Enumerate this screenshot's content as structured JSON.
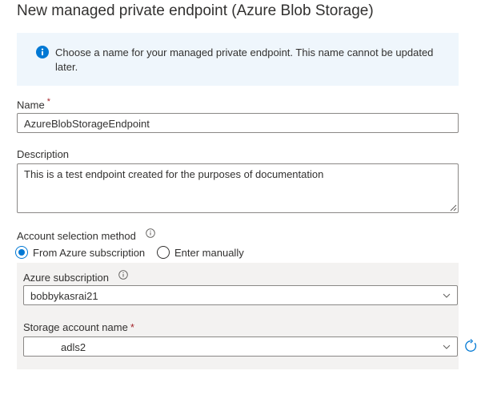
{
  "title": "New managed private endpoint (Azure Blob Storage)",
  "info": {
    "icon": "info-icon",
    "text": "Choose a name for your managed private endpoint. This name cannot be updated later."
  },
  "name_field": {
    "label": "Name",
    "required_mark": "*",
    "value": "AzureBlobStorageEndpoint"
  },
  "description_field": {
    "label": "Description",
    "value": "This is a test endpoint created for the purposes of documentation"
  },
  "account_selection": {
    "label": "Account selection method",
    "options": [
      {
        "label": "From Azure subscription",
        "selected": true
      },
      {
        "label": "Enter manually",
        "selected": false
      }
    ]
  },
  "azure_subscription": {
    "label": "Azure subscription",
    "value": "bobbykasrai21"
  },
  "storage_account": {
    "label": "Storage account name",
    "required_mark": "*",
    "value": "adls2"
  },
  "colors": {
    "accent": "#0078d4",
    "required": "#a4262c",
    "info_bg": "#eff6fc",
    "panel_bg": "#f3f2f1"
  }
}
